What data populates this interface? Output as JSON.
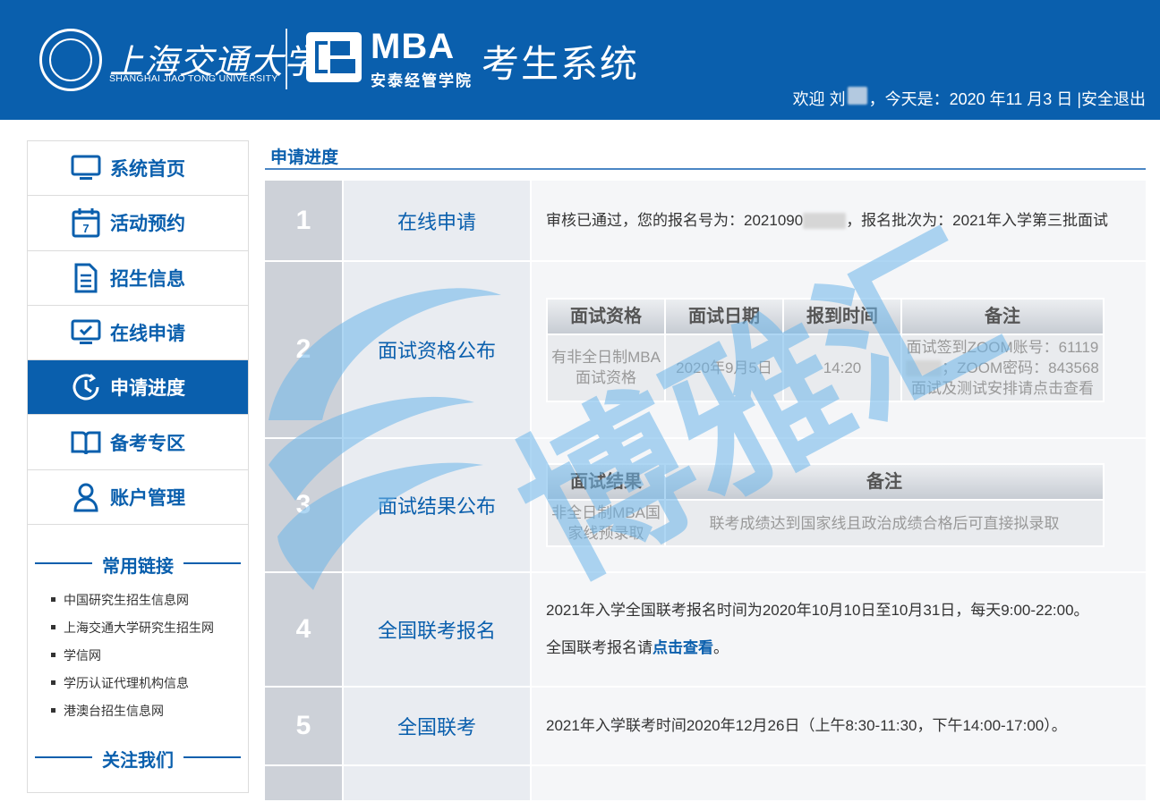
{
  "header": {
    "sjtu_name_cn": "上海交通大学",
    "sjtu_name_en": "SHANGHAI JIAO TONG UNIVERSITY",
    "mba_label": "MBA",
    "school_name": "安泰经管学院",
    "system_title": "考生系统",
    "welcome_prefix": "欢迎 刘",
    "welcome_today": "，今天是：2020 年11 月3 日 |",
    "logout_label": "安全退出",
    "brand_color": "#0a5fad"
  },
  "sidebar": {
    "items": [
      {
        "label": "系统首页",
        "icon": "monitor-icon"
      },
      {
        "label": "活动预约",
        "icon": "calendar-icon"
      },
      {
        "label": "招生信息",
        "icon": "document-icon"
      },
      {
        "label": "在线申请",
        "icon": "screen-check-icon"
      },
      {
        "label": "申请进度",
        "icon": "clock-icon",
        "active": true
      },
      {
        "label": "备考专区",
        "icon": "book-icon"
      },
      {
        "label": "账户管理",
        "icon": "user-icon"
      }
    ],
    "links_title": "常用链接",
    "links": [
      "中国研究生招生信息网",
      "上海交通大学研究生招生网",
      "学信网",
      "学历认证代理机构信息",
      "港澳台招生信息网"
    ],
    "follow_title": "关注我们"
  },
  "main": {
    "title": "申请进度",
    "steps": [
      {
        "num": "1",
        "name": "在线申请",
        "desc_a": "审核已通过，您的报名号为：2021090",
        "desc_b": "，报名批次为：2021年入学第三批面试"
      },
      {
        "num": "2",
        "name": "面试资格公布",
        "table": {
          "headers": [
            "面试资格",
            "面试日期",
            "报到时间",
            "备注"
          ],
          "row": {
            "qualification": "有非全日制MBA面试资格",
            "date": "2020年9月5日",
            "time": "14:20",
            "note_a": "面试签到ZOOM账号：61119",
            "note_b": "；ZOOM密码：843568",
            "note_c": "面试及测试安排请点击查看"
          }
        }
      },
      {
        "num": "3",
        "name": "面试结果公布",
        "table": {
          "headers": [
            "面试结果",
            "备注"
          ],
          "row": {
            "result": "非全日制MBA国家线预录取",
            "note": "联考成绩达到国家线且政治成绩合格后可直接拟录取"
          }
        }
      },
      {
        "num": "4",
        "name": "全国联考报名",
        "line1": "2021年入学全国联考报名时间为2020年10月10日至10月31日，每天9:00-22:00。",
        "line2_a": "全国联考报名请",
        "line2_link": "点击查看",
        "line2_b": "。"
      },
      {
        "num": "5",
        "name": "全国联考",
        "line1": "2021年入学联考时间2020年12月26日（上午8:30-11:30，下午14:00-17:00）。"
      },
      {
        "num": "",
        "name": ""
      }
    ]
  },
  "watermark": {
    "text": "博雅汇",
    "color": "#6db6ea"
  }
}
